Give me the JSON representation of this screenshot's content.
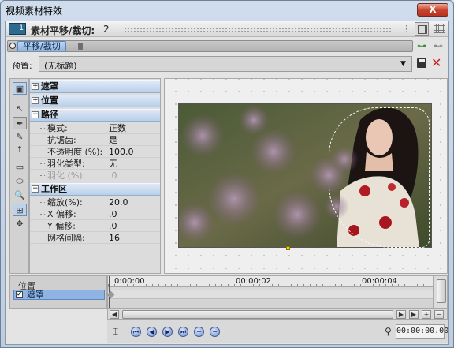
{
  "window": {
    "title": "视频素材特效",
    "close_label": "X"
  },
  "header": {
    "effect_title": "素材平移/裁切:",
    "effect_count": "2"
  },
  "chain": {
    "selected_effect": "平移/裁切"
  },
  "preset": {
    "label": "预置:",
    "value": "(无标题)"
  },
  "properties": {
    "groups": {
      "mask": "遮罩",
      "position": "位置",
      "path": "路径",
      "workspace": "工作区"
    },
    "path_rows": [
      {
        "key": "模式:",
        "value": "正数",
        "disabled": false
      },
      {
        "key": "抗锯齿:",
        "value": "是",
        "disabled": false
      },
      {
        "key": "不透明度 (%):",
        "value": "100.0",
        "disabled": false
      },
      {
        "key": "羽化类型:",
        "value": "无",
        "disabled": false
      },
      {
        "key": "羽化 (%):",
        "value": ".0",
        "disabled": true
      }
    ],
    "workspace_rows": [
      {
        "key": "缩放(%):",
        "value": "20.0"
      },
      {
        "key": "X 偏移:",
        "value": ".0"
      },
      {
        "key": "Y 偏移:",
        "value": ".0"
      },
      {
        "key": "网格间隔:",
        "value": "16"
      }
    ]
  },
  "timeline": {
    "tracks_header": "位置",
    "track_label": "遮罩",
    "track_checked": "✔",
    "timecodes": [
      "0:00:00",
      "00:00:02",
      "00:00:04"
    ],
    "current_time": "00:00:00.00"
  },
  "colors": {
    "accent": "#8fb4e3",
    "selection_outline": "#fafafa",
    "handle": "#ffd800",
    "close_button": "#c7402a"
  }
}
